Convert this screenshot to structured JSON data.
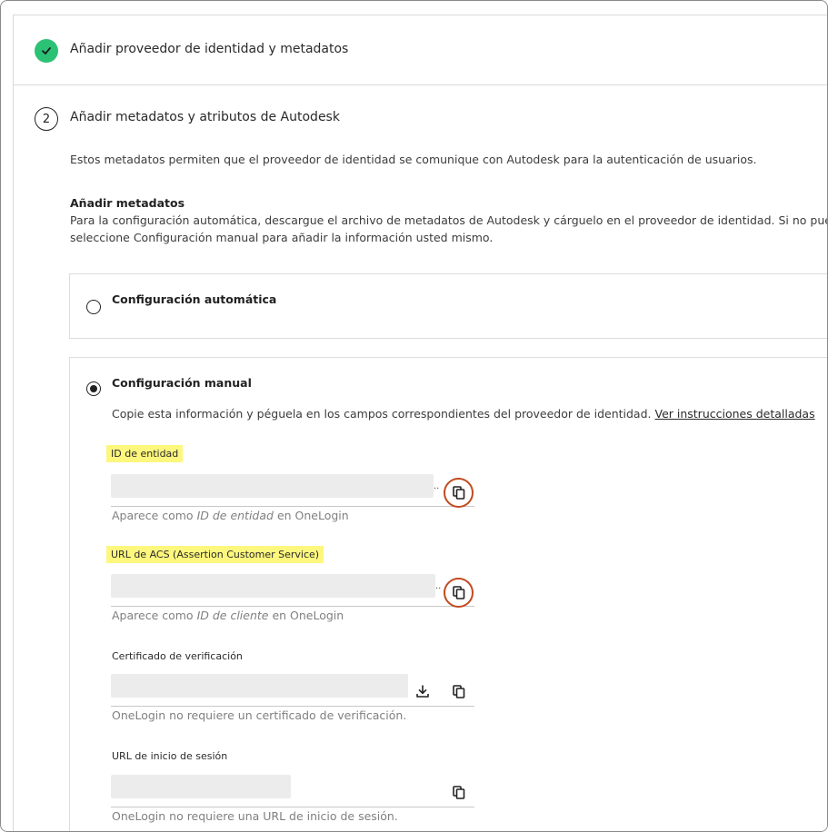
{
  "step1": {
    "title": "Añadir proveedor de identidad y metadatos"
  },
  "step2": {
    "number": "2",
    "title": "Añadir metadatos y atributos de Autodesk",
    "description": "Estos metadatos permiten que el proveedor de identidad se comunique con Autodesk para la autenticación de usuarios.",
    "metadata_heading": "Añadir metadatos",
    "metadata_line1": "Para la configuración automática, descargue el archivo de metadatos de Autodesk y cárguelo en el proveedor de identidad. Si no puede cargarlo,",
    "metadata_line2": "seleccione Configuración manual para añadir la información usted mismo."
  },
  "options": {
    "auto": {
      "label": "Configuración automática",
      "selected": false
    },
    "manual": {
      "label": "Configuración manual",
      "selected": true,
      "instructions": "Copie esta información y péguela en los campos correspondientes del proveedor de identidad.",
      "link": "Ver instrucciones detalladas"
    }
  },
  "fields": {
    "entity_id": {
      "label": "ID de entidad",
      "helper_prefix": "Aparece como ",
      "helper_em": "ID de entidad",
      "helper_suffix": " en OneLogin",
      "ellipsis": ".."
    },
    "acs_url": {
      "label": "URL de ACS (Assertion Customer Service)",
      "helper_prefix": "Aparece como ",
      "helper_em": "ID de cliente",
      "helper_suffix": " en OneLogin",
      "ellipsis": ".."
    },
    "cert": {
      "label": "Certificado de verificación",
      "helper": "OneLogin no requiere un certificado de verificación."
    },
    "login_url": {
      "label": "URL de inicio de sesión",
      "helper": "OneLogin no requiere una URL de inicio de sesión."
    }
  },
  "icons": {
    "check": "check-icon",
    "copy": "copy-icon",
    "download": "download-icon"
  },
  "colors": {
    "success": "#2bc275",
    "highlight": "#fdf77d",
    "annotation_ring": "#c24a1f"
  }
}
